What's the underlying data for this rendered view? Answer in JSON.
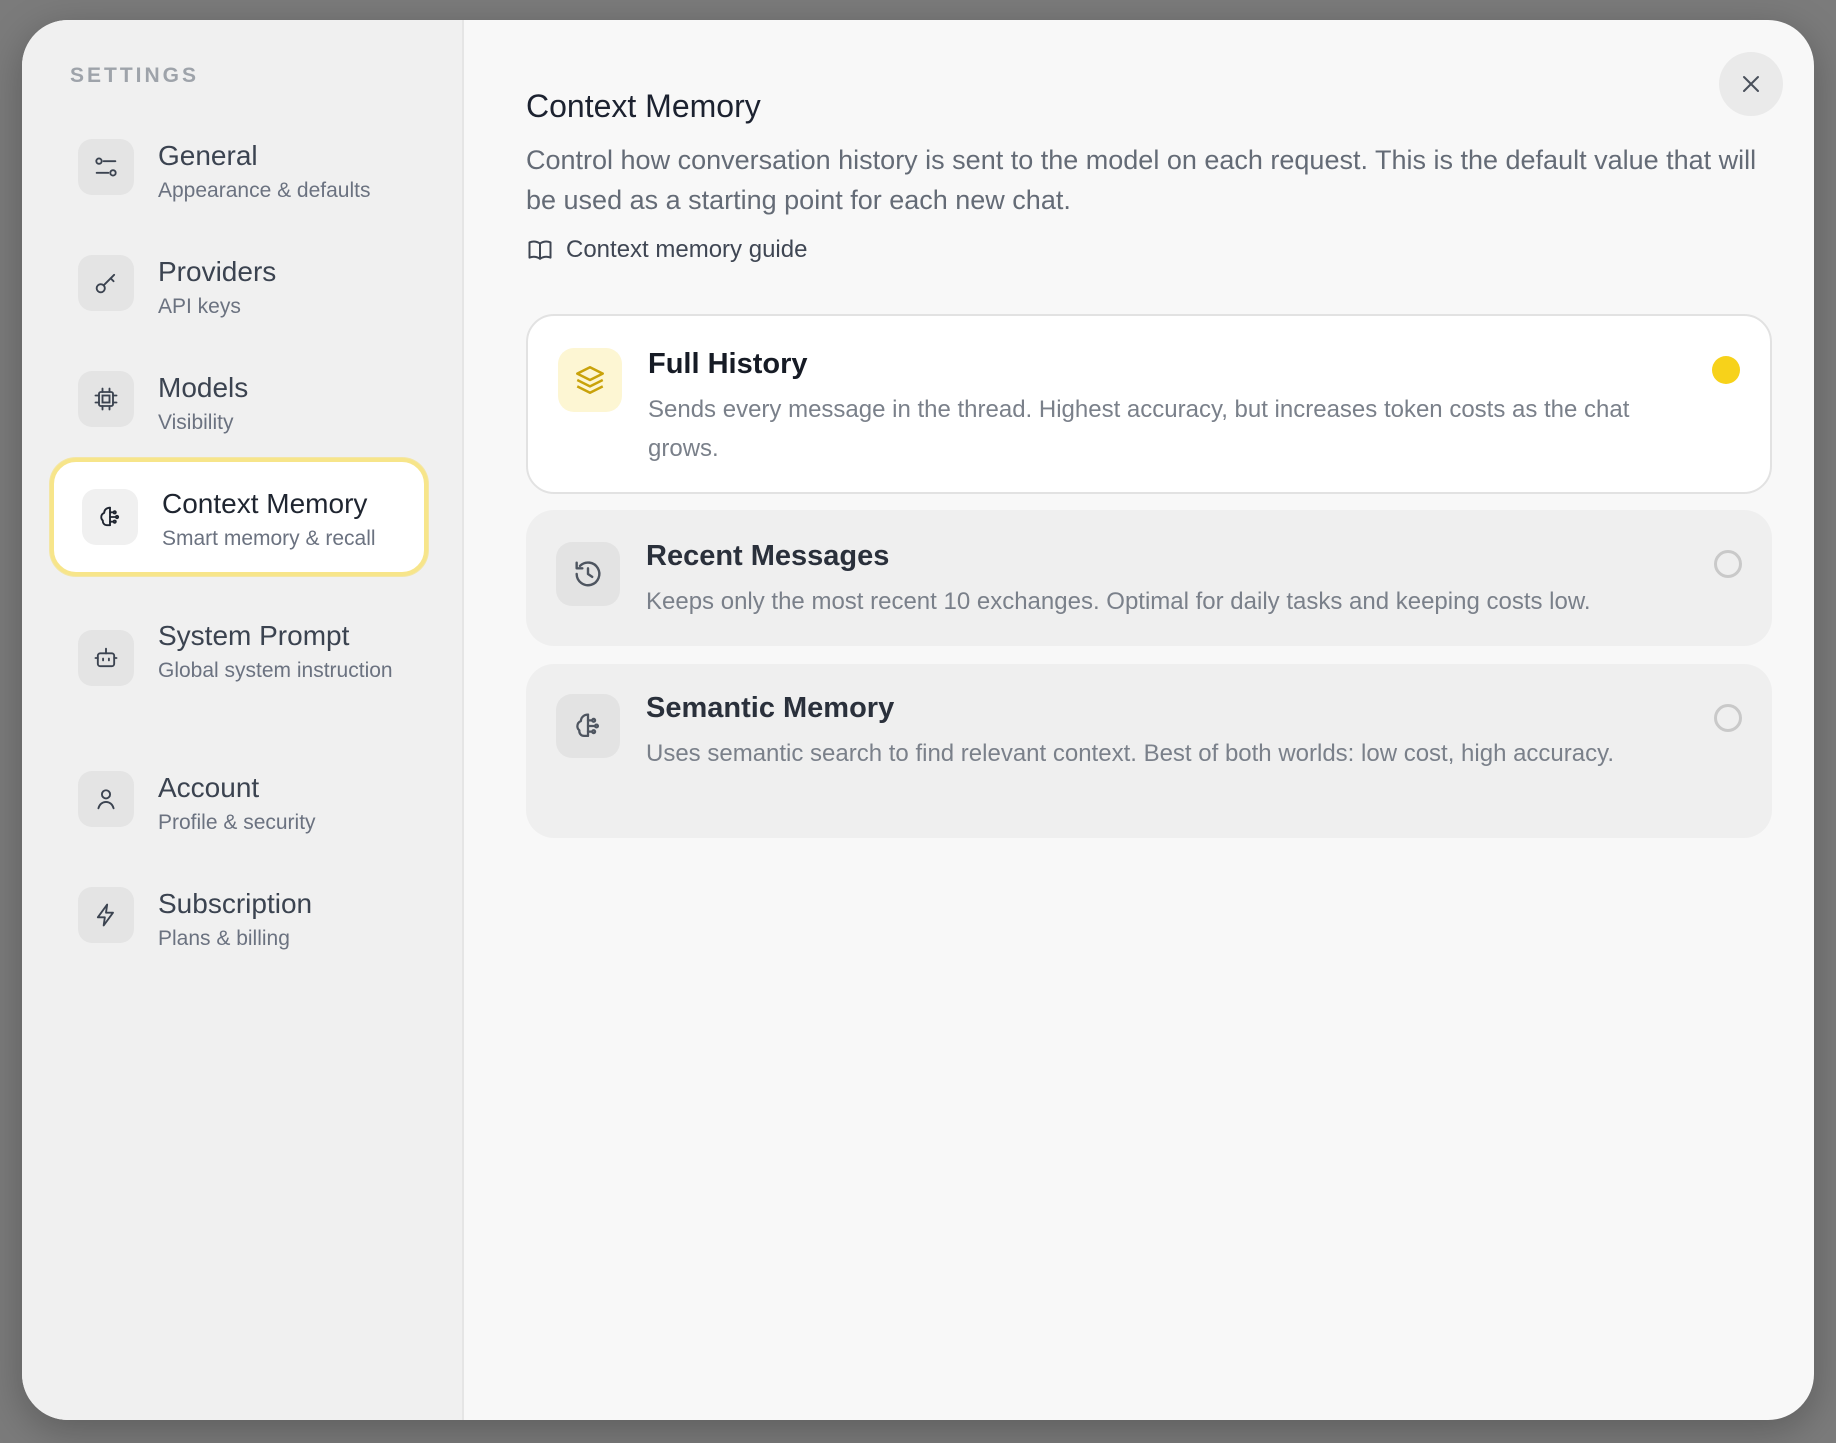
{
  "sidebar": {
    "title": "SETTINGS",
    "items": [
      {
        "label": "General",
        "sub": "Appearance & defaults",
        "icon": "sliders-icon"
      },
      {
        "label": "Providers",
        "sub": "API keys",
        "icon": "key-icon"
      },
      {
        "label": "Models",
        "sub": "Visibility",
        "icon": "cpu-chip-icon"
      },
      {
        "label": "Context Memory",
        "sub": "Smart memory & recall",
        "icon": "brain-icon",
        "active": true
      },
      {
        "label": "System Prompt",
        "sub": "Global system instruction",
        "icon": "bot-icon"
      },
      {
        "label": "Account",
        "sub": "Profile & security",
        "icon": "user-icon"
      },
      {
        "label": "Subscription",
        "sub": "Plans & billing",
        "icon": "lightning-icon"
      }
    ]
  },
  "main": {
    "title": "Context Memory",
    "description": "Control how conversation history is sent to the model on each request. This is the default value that will be used as a starting point for each new chat.",
    "guide_link": "Context memory guide",
    "options": [
      {
        "title": "Full History",
        "description": "Sends every message in the thread. Highest accuracy, but increases token costs as the chat grows.",
        "icon": "layers-icon",
        "selected": true
      },
      {
        "title": "Recent Messages",
        "description": "Keeps only the most recent 10 exchanges. Optimal for daily tasks and keeping costs low.",
        "icon": "history-icon",
        "selected": false
      },
      {
        "title": "Semantic Memory",
        "description": "Uses semantic search to find relevant context. Best of both worlds: low cost, high accuracy.",
        "icon": "brain-icon",
        "selected": false
      }
    ]
  },
  "colors": {
    "accent": "#f7d21a",
    "active_border": "#f7e58a"
  }
}
